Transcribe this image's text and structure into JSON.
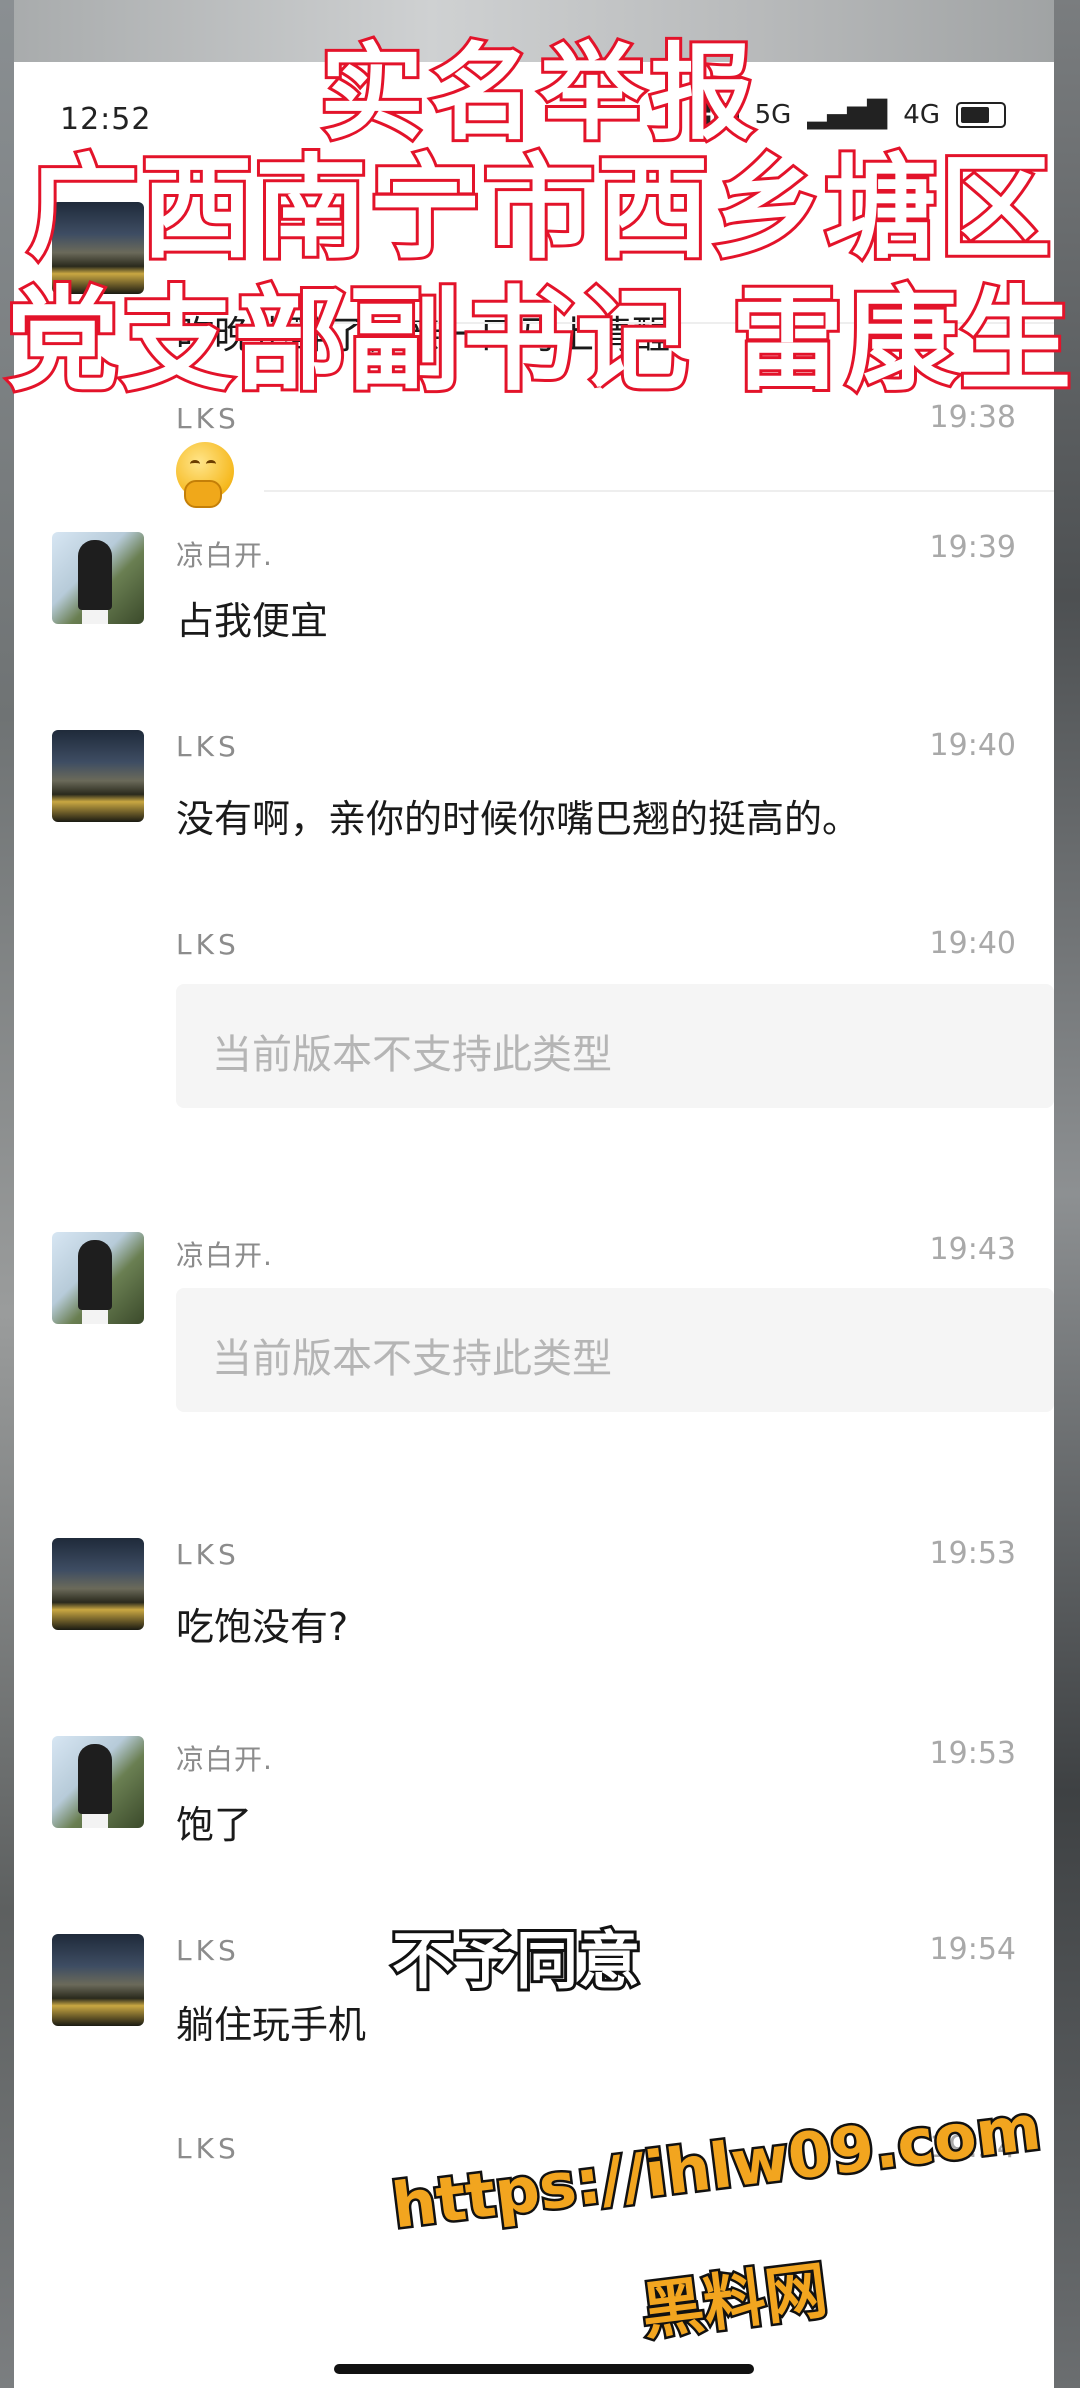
{
  "status_bar": {
    "time": "12:52",
    "hd": "HD",
    "network": "5G",
    "signal2": "4G"
  },
  "messages": [
    {
      "type": "text",
      "text": "昨晚也醉了，亲一口马上清醒"
    },
    {
      "type": "emoji",
      "sender": "LKS",
      "time": "19:38",
      "emoji": "hugging-face"
    },
    {
      "type": "text",
      "sender": "凉白开.",
      "time": "19:39",
      "text": "占我便宜"
    },
    {
      "type": "text",
      "sender": "LKS",
      "time": "19:40",
      "text": "没有啊，亲你的时候你嘴巴翘的挺高的。"
    },
    {
      "type": "unsupported",
      "sender": "LKS",
      "time": "19:40",
      "text": "当前版本不支持此类型"
    },
    {
      "type": "unsupported",
      "sender": "凉白开.",
      "time": "19:43",
      "text": "当前版本不支持此类型"
    },
    {
      "type": "text",
      "sender": "LKS",
      "time": "19:53",
      "text": "吃饱没有?"
    },
    {
      "type": "text",
      "sender": "凉白开.",
      "time": "19:53",
      "text": "饱了"
    },
    {
      "type": "text",
      "sender": "LKS",
      "time": "19:54",
      "text": "躺住玩手机"
    },
    {
      "type": "text",
      "sender": "LKS",
      "time": "19:54",
      "text": ""
    }
  ],
  "overlay": {
    "headline_1": "实名举报",
    "headline_2": "广西南宁市西乡塘区",
    "headline_3": "党支部副书记 雷康生",
    "subtitle": "不予同意",
    "watermark_url": "https://ihlw09.com",
    "watermark_name": "黑料网"
  },
  "colors": {
    "headline_fill": "#ffffff",
    "headline_stroke": "#e3142b",
    "watermark": "#f2a51f"
  }
}
